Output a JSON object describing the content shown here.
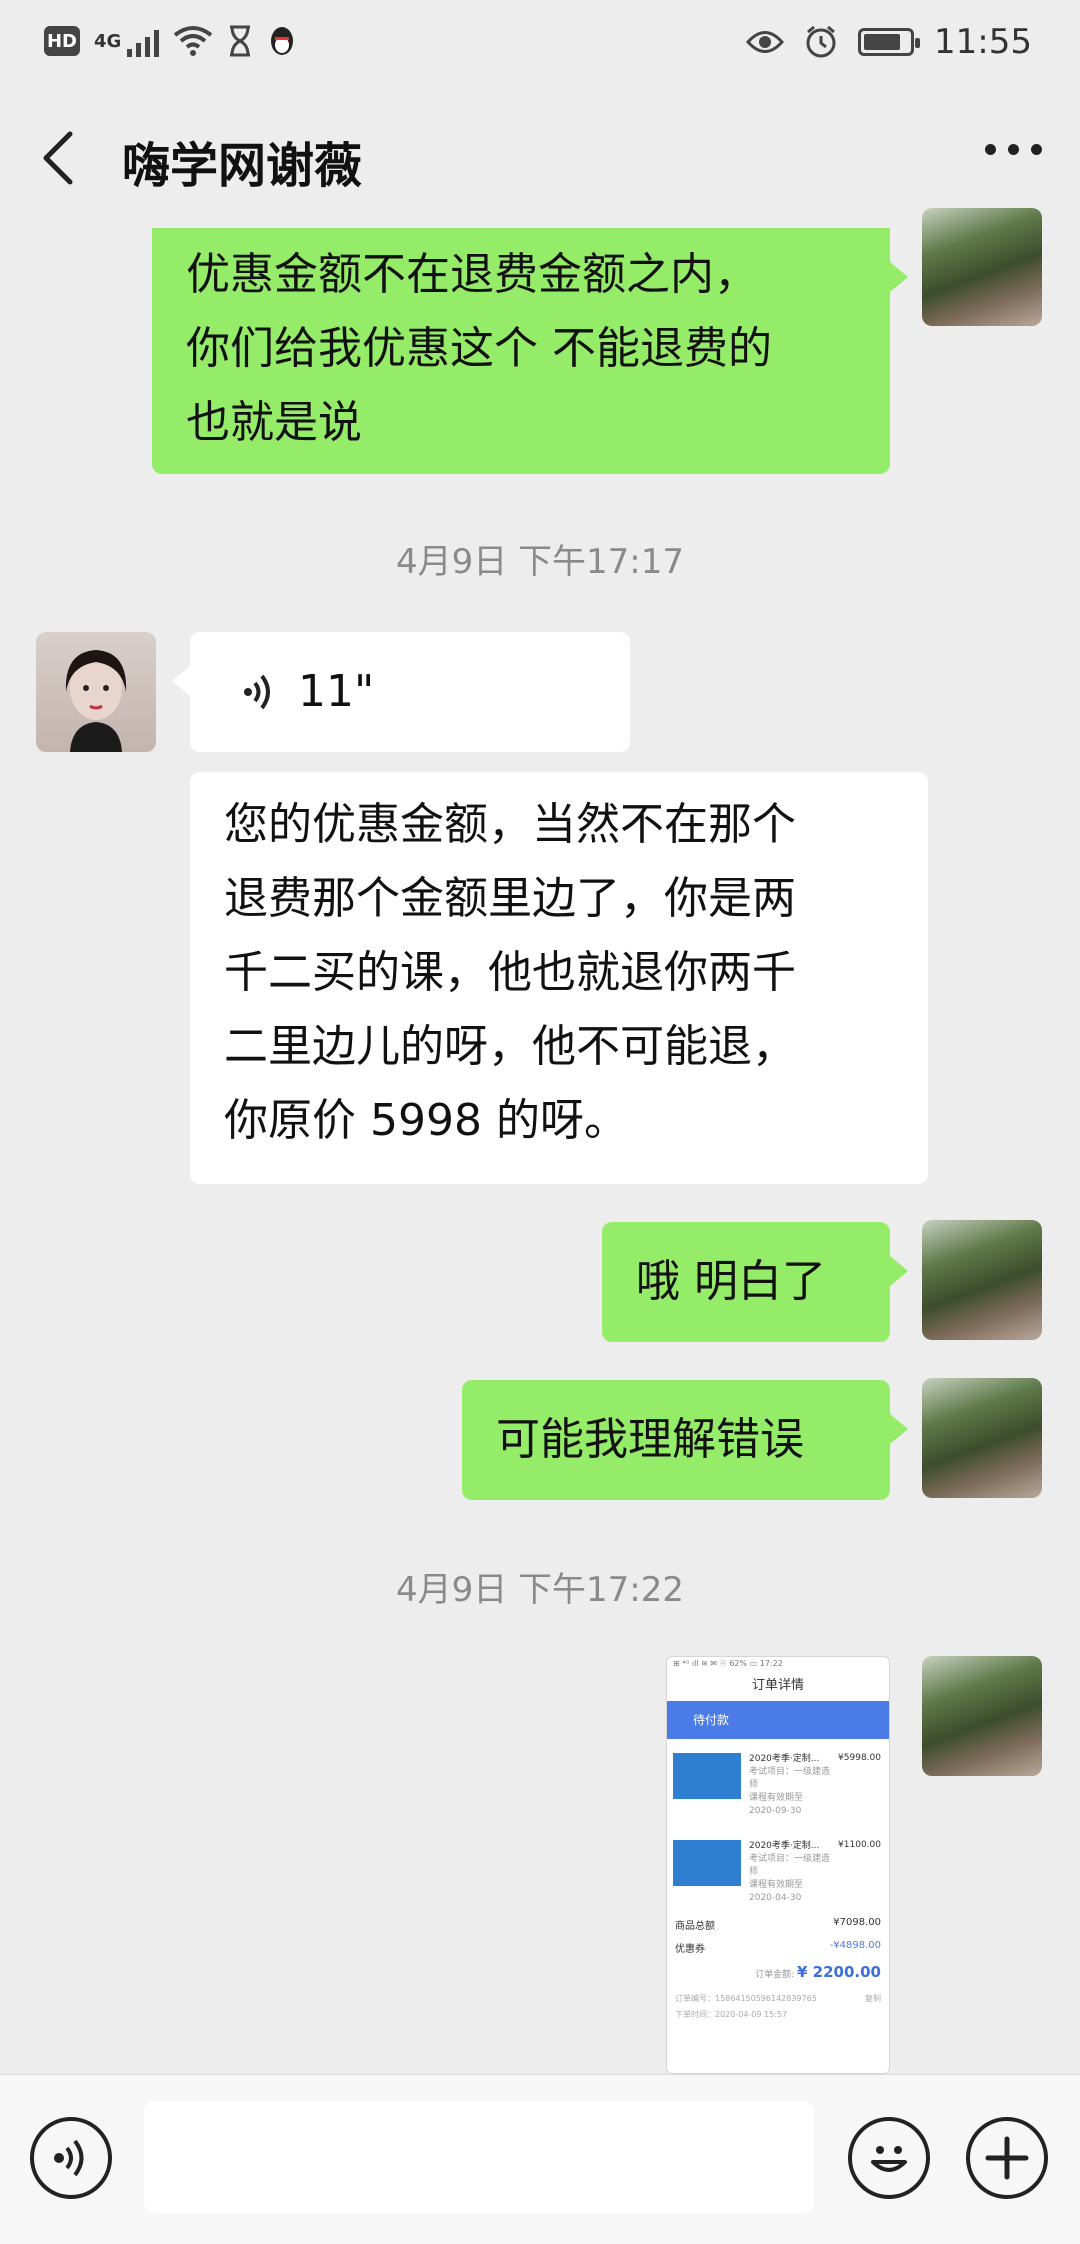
{
  "status_bar": {
    "hd_badge": "HD",
    "network": "4G",
    "time": "11:55"
  },
  "header": {
    "title": "嗨学网谢薇"
  },
  "messages": {
    "m1_text": "优惠金额不在退费金额之内，\n你们给我优惠这个 不能退费的\n也就是说",
    "time1": "4月9日 下午17:17",
    "voice_duration": "11\"",
    "m3_text": "您的优惠金额，当然不在那个\n退费那个金额里边了，你是两\n千二买的课，他也就退你两千\n二里边儿的呀，他不可能退，\n你原价 5998 的呀。",
    "m4_text": "哦 明白了",
    "m5_text": "可能我理解错误",
    "time2": "4月9日 下午17:22"
  },
  "screenshot_thumb": {
    "status": "⊞ ⁴ᴳ ıll ≋ ✉      ☉ 62% ▭ 17:22",
    "title": "订单详情",
    "band": "待付款",
    "item1_name": "2020考季·定制...",
    "item1_price": "¥5998.00",
    "item1_sub1": "考试项目：一级建造师",
    "item1_sub2": "课程有效期至",
    "item1_sub3": "2020-09-30",
    "item2_name": "2020考季·定制...",
    "item2_price": "¥1100.00",
    "item2_sub1": "考试项目：一级建造师",
    "item2_sub2": "课程有效期至",
    "item2_sub3": "2020-04-30",
    "goods_total_label": "商品总额",
    "goods_total": "¥7098.00",
    "coupon_label": "优惠券",
    "coupon": "-¥4898.00",
    "order_amount_label": "订单金额:",
    "order_amount": "¥ 2200.00",
    "order_no": "订单编号：15864150596142839765",
    "copy": "复制",
    "order_time": "下单时间：2020-04-09 15:57"
  },
  "icons": {
    "back": "back-arrow-icon",
    "more": "more-dots-icon",
    "voice": "voice-icon",
    "emoji": "emoji-icon",
    "plus": "plus-icon"
  },
  "colors": {
    "outgoing_bubble": "#95ec69",
    "incoming_bubble": "#ffffff",
    "background": "#ededed"
  }
}
